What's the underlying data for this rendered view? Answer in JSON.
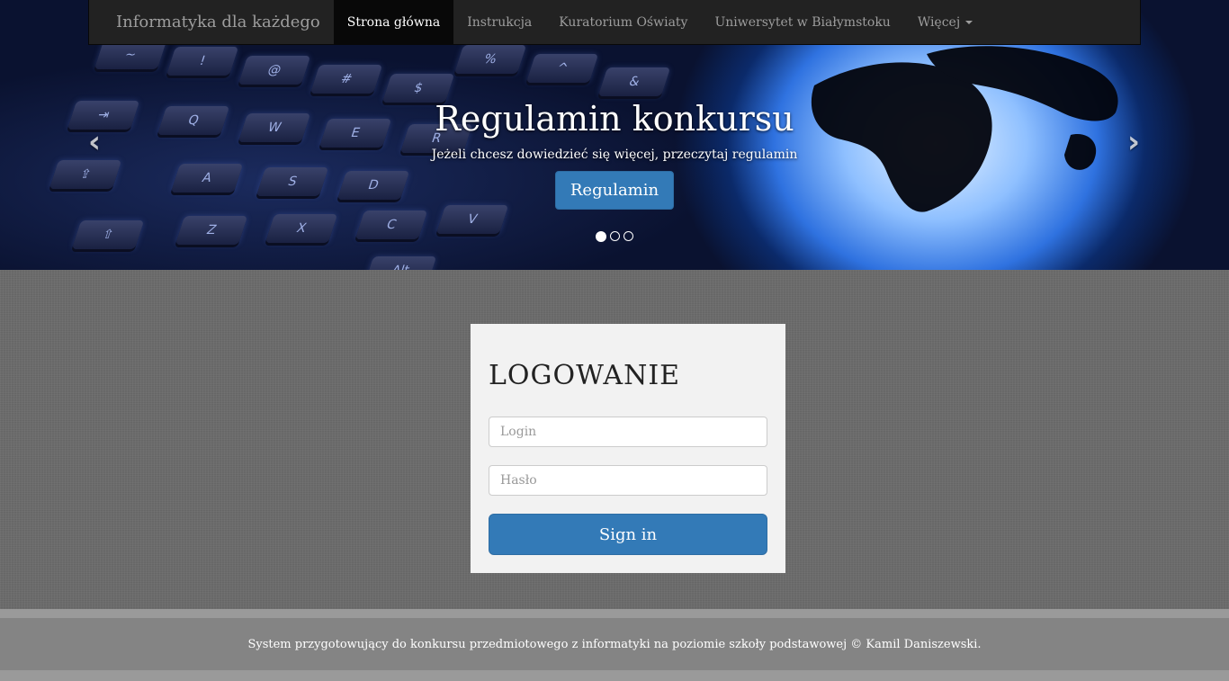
{
  "navbar": {
    "brand": "Informatyka dla każdego",
    "items": [
      {
        "label": "Strona główna",
        "active": true
      },
      {
        "label": "Instrukcja",
        "active": false
      },
      {
        "label": "Kuratorium Oświaty",
        "active": false
      },
      {
        "label": "Uniwersytet w Białymstoku",
        "active": false
      },
      {
        "label": "Więcej",
        "active": false,
        "dropdown": true
      }
    ]
  },
  "carousel": {
    "title": "Regulamin konkursu",
    "text": "Jeżeli chcesz dowiedzieć się więcej, przeczytaj regulamin",
    "button": "Regulamin",
    "prev_icon": "‹",
    "next_icon": "›",
    "slides_total": 3,
    "active_slide": 1
  },
  "login": {
    "title": "LOGOWANIE",
    "login_placeholder": "Login",
    "password_placeholder": "Hasło",
    "submit": "Sign in"
  },
  "footer": {
    "text": "System przygotowujący do konkursu przedmiotowego z informatyki na poziomie szkoły podstawowej © Kamil Daniszewski."
  },
  "colors": {
    "primary": "#337ab7",
    "navbar": "#222222"
  }
}
